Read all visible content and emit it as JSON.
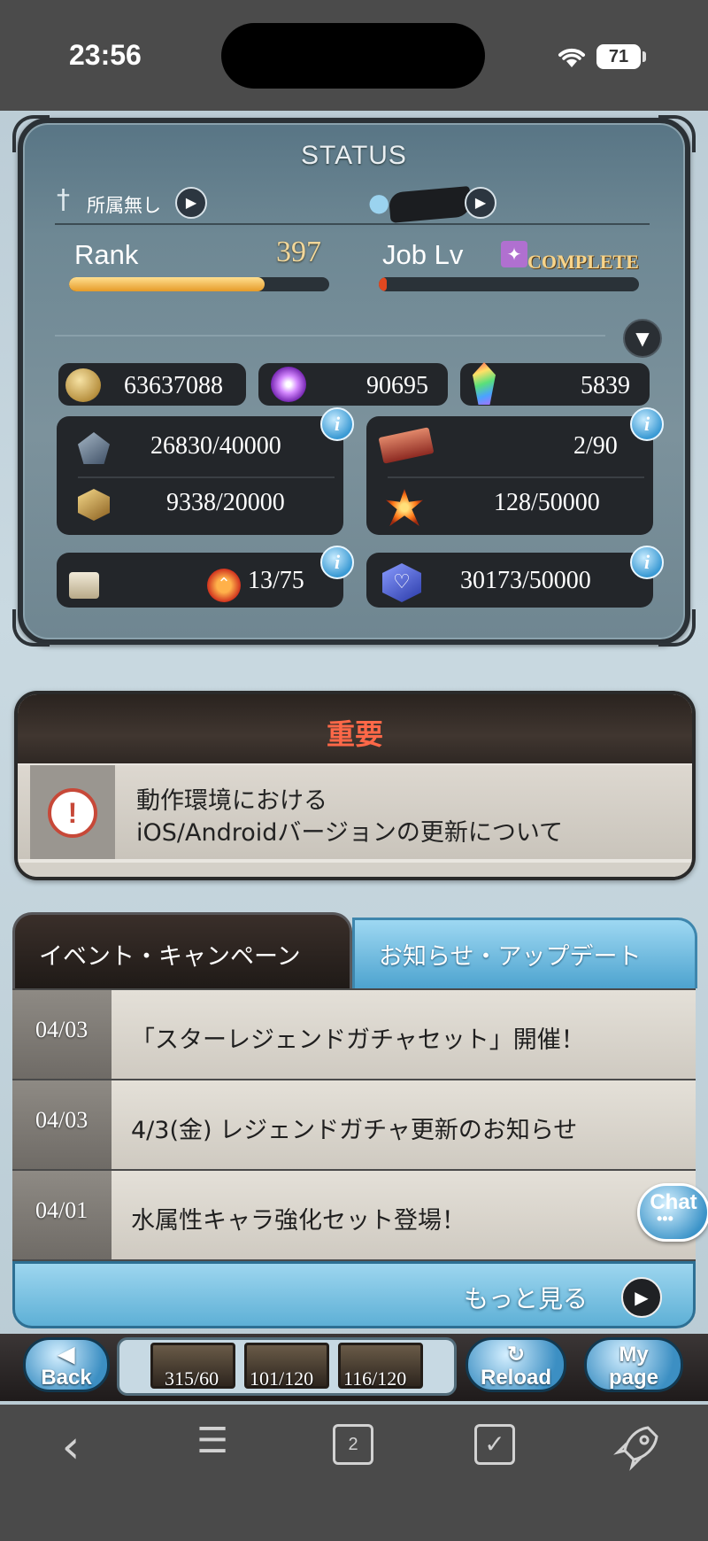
{
  "system": {
    "time": "23:56",
    "battery": "71"
  },
  "status": {
    "title": "STATUS",
    "guild_label": "所属無し",
    "rank_label": "Rank",
    "rank_value": "397",
    "rank_progress": 0.75,
    "job_label": "Job Lv",
    "job_status": "COMPLETE",
    "job_progress": 0.02,
    "currencies": {
      "crystal": "63637088",
      "jewel": "90695",
      "gem": "5839"
    },
    "resources": {
      "weapon": "26830/40000",
      "summon": "9338/20000",
      "ticket": "2/90",
      "burst": "128/50000",
      "rankup": "13/75",
      "heart": "30173/50000"
    },
    "info_icon": "i"
  },
  "notice": {
    "title": "重要",
    "line1": "動作環境における",
    "line2": "iOS/Androidバージョンの更新について"
  },
  "news": {
    "tabs": [
      {
        "label": "イベント・キャンペーン",
        "active": true
      },
      {
        "label": "お知らせ・アップデート",
        "active": false
      }
    ],
    "items": [
      {
        "date": "04/03",
        "title": "「スターレジェンドガチャセット」開催！"
      },
      {
        "date": "04/03",
        "title": "4/3(金) レジェンドガチャ更新のお知らせ"
      },
      {
        "date": "04/01",
        "title": "水属性キャラ強化セット登場！"
      }
    ],
    "more_label": "もっと見る",
    "chat_label": "Chat"
  },
  "game_toolbar": {
    "back_line1": "◀",
    "back_line2": "Back",
    "reload_line1": "↻",
    "reload_line2": "Reload",
    "mypage_line1": "My",
    "mypage_line2": "page",
    "stamina": [
      "315/60",
      "101/120",
      "116/120"
    ]
  },
  "browser": {
    "tab_count": "2"
  },
  "colors": {
    "accent_blue": "#4da3cf",
    "notice_red": "#ff6848",
    "rank_bar": "#e69b28",
    "job_bar": "#e04820"
  },
  "icons": {
    "wifi": "wifi-icon",
    "back": "chevron-left-icon",
    "menu": "hamburger-menu-icon",
    "tabs": "tabs-icon",
    "check": "checkbox-icon",
    "rocket": "rocket-icon"
  }
}
